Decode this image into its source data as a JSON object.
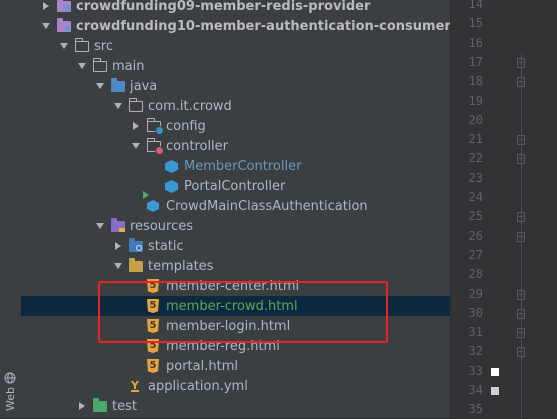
{
  "side_tab": {
    "label": "Web"
  },
  "tree": {
    "rows": [
      {
        "label": "crowdfunding09-member-redis-provider",
        "depth": 1,
        "state": "collapsed",
        "icon": "module-folder",
        "style": "bold"
      },
      {
        "label": "crowdfunding10-member-authentication-consumer",
        "depth": 1,
        "state": "expanded",
        "icon": "module-folder",
        "style": "bold"
      },
      {
        "label": "src",
        "depth": 2,
        "state": "expanded",
        "icon": "folder",
        "style": "normal"
      },
      {
        "label": "main",
        "depth": 3,
        "state": "expanded",
        "icon": "folder",
        "style": "normal"
      },
      {
        "label": "java",
        "depth": 4,
        "state": "expanded",
        "icon": "source-folder",
        "style": "normal"
      },
      {
        "label": "com.it.crowd",
        "depth": 5,
        "state": "expanded",
        "icon": "package",
        "style": "normal"
      },
      {
        "label": "config",
        "depth": 6,
        "state": "collapsed",
        "icon": "config-package",
        "style": "normal"
      },
      {
        "label": "controller",
        "depth": 6,
        "state": "expanded",
        "icon": "controller-package",
        "style": "normal"
      },
      {
        "label": "MemberController",
        "depth": 7,
        "state": "leaf",
        "icon": "class",
        "style": "blue"
      },
      {
        "label": "PortalController",
        "depth": 7,
        "state": "leaf",
        "icon": "class",
        "style": "normal"
      },
      {
        "label": "CrowdMainClassAuthentication",
        "depth": 6,
        "state": "leaf",
        "icon": "main-class",
        "style": "normal"
      },
      {
        "label": "resources",
        "depth": 4,
        "state": "expanded",
        "icon": "resources-folder",
        "style": "normal"
      },
      {
        "label": "static",
        "depth": 5,
        "state": "collapsed",
        "icon": "static-folder",
        "style": "normal"
      },
      {
        "label": "templates",
        "depth": 5,
        "state": "expanded",
        "icon": "templates-folder",
        "style": "normal"
      },
      {
        "label": "member-center.html",
        "depth": 6,
        "state": "leaf",
        "icon": "html",
        "style": "normal"
      },
      {
        "label": "member-crowd.html",
        "depth": 6,
        "state": "leaf",
        "icon": "html",
        "style": "green",
        "selected": true
      },
      {
        "label": "member-login.html",
        "depth": 6,
        "state": "leaf",
        "icon": "html",
        "style": "normal"
      },
      {
        "label": "member-reg.html",
        "depth": 6,
        "state": "leaf",
        "icon": "html",
        "style": "normal"
      },
      {
        "label": "portal.html",
        "depth": 6,
        "state": "leaf",
        "icon": "html",
        "style": "normal"
      },
      {
        "label": "application.yml",
        "depth": 5,
        "state": "leaf",
        "icon": "yml",
        "style": "normal"
      },
      {
        "label": "test",
        "depth": 3,
        "state": "collapsed",
        "icon": "test-folder",
        "style": "normal"
      }
    ]
  },
  "gutter": {
    "line_numbers": [
      "14",
      "15",
      "16",
      "17",
      "18",
      "19",
      "20",
      "21",
      "22",
      "23",
      "24",
      "25",
      "26",
      "27",
      "28",
      "29",
      "30",
      "31",
      "32",
      "33",
      "34",
      "35"
    ],
    "bookmarks": [
      "33",
      "34"
    ]
  },
  "colors": {
    "tree_bg": "#3c3f41",
    "selected_row_bg": "#0d293e",
    "highlight_box": "#e82424",
    "html_icon": "#e8a33d",
    "class_icon": "#3a98d5"
  }
}
